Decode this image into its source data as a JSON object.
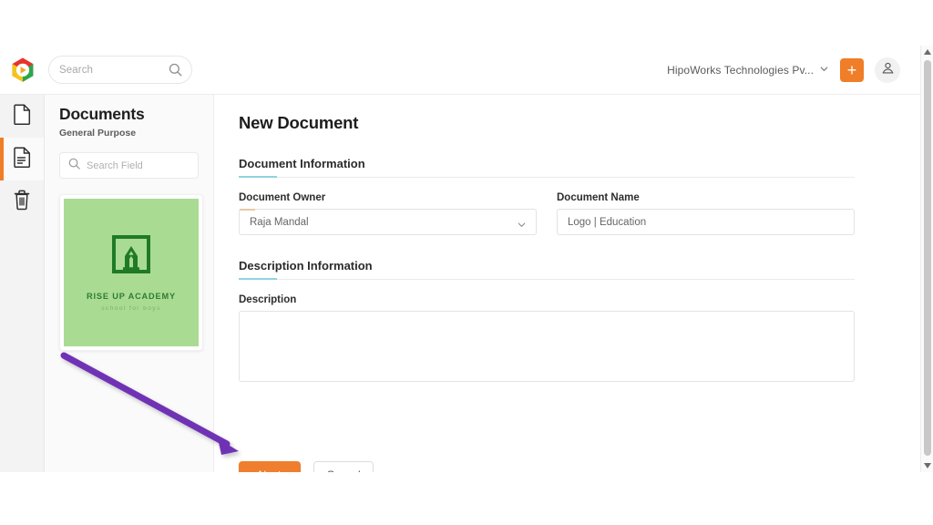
{
  "topbar": {
    "logo_icon": "hexagon-play-logo",
    "search": {
      "placeholder": "Search",
      "value": "",
      "icon": "search-icon"
    },
    "org": {
      "name": "HipoWorks Technologies Pv...",
      "chevron_icon": "chevron-down-icon"
    },
    "add_button": {
      "label": "+",
      "icon": "plus-icon",
      "color": "#f07d28"
    },
    "account": {
      "icon": "user-account-icon"
    }
  },
  "rail": {
    "items": [
      {
        "name": "document-blank",
        "icon": "file-icon",
        "active": false
      },
      {
        "name": "document-lines",
        "icon": "file-text-icon",
        "active": true
      },
      {
        "name": "trash",
        "icon": "trash-icon",
        "active": false
      }
    ],
    "active_indicator_color": "#f07d28"
  },
  "sidebar": {
    "title": "Documents",
    "subtitle": "General Purpose",
    "search": {
      "placeholder": "Search Field",
      "value": "",
      "icon": "search-icon"
    },
    "thumbnail": {
      "name": "RISE UP ACADEMY",
      "tagline": "school for boys",
      "bg_color": "#aadb93",
      "mark_color": "#2e7d32",
      "icon": "academy-square-pencil-logo"
    }
  },
  "main": {
    "page_title": "New Document",
    "sections": [
      {
        "heading": "Document Information",
        "accent_color": "#8fd4de",
        "fields": [
          {
            "label": "Document Owner",
            "value": "Raja Mandal",
            "type": "select",
            "icon": "chevron-down-icon"
          },
          {
            "label": "Document Name",
            "value": "Logo | Education",
            "type": "text"
          }
        ]
      },
      {
        "heading": "Description Information",
        "accent_color": "#8fd4de",
        "fields": [
          {
            "label": "Description",
            "value": "",
            "type": "textarea"
          }
        ]
      }
    ],
    "buttons": {
      "next": {
        "label": "Next",
        "color": "#ef7f2e"
      },
      "cancel": {
        "label": "Cancel"
      }
    }
  },
  "scrollbar": {
    "up_icon": "caret-up-icon",
    "down_icon": "caret-down-icon"
  },
  "annotation": {
    "arrow_color": "#6f32b5",
    "target": "next-button"
  }
}
